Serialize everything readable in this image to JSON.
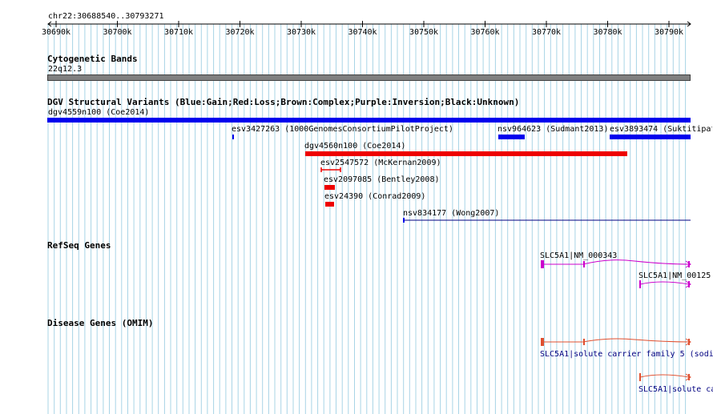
{
  "ruler": {
    "region": "chr22:30688540..30793271",
    "ticks": [
      "30690k",
      "30700k",
      "30710k",
      "30720k",
      "30730k",
      "30740k",
      "30750k",
      "30760k",
      "30770k",
      "30780k",
      "30790k"
    ]
  },
  "cytobands": {
    "title": "Cytogenetic Bands",
    "band": "22q12.3"
  },
  "dgv": {
    "title": "DGV Structural Variants (Blue:Gain;Red:Loss;Brown:Complex;Purple:Inversion;Black:Unknown)",
    "variants": [
      {
        "label": "dgv4559n100 (Coe2014)",
        "type": "gain"
      },
      {
        "label": "esv3427263 (1000GenomesConsortiumPilotProject)",
        "type": "gain"
      },
      {
        "label": "nsv964623 (Sudmant2013)",
        "type": "gain"
      },
      {
        "label": "esv3893474 (Suktitipat",
        "type": "gain"
      },
      {
        "label": "dgv4560n100 (Coe2014)",
        "type": "loss"
      },
      {
        "label": "esv2547572 (McKernan2009)",
        "type": "loss"
      },
      {
        "label": "esv2097085 (Bentley2008)",
        "type": "loss"
      },
      {
        "label": "esv24390 (Conrad2009)",
        "type": "loss"
      },
      {
        "label": "nsv834177 (Wong2007)",
        "type": "gain"
      }
    ]
  },
  "refseq": {
    "title": "RefSeq Genes",
    "genes": [
      {
        "label": "SLC5A1|NM_000343"
      },
      {
        "label": "SLC5A1|NM_00125"
      }
    ]
  },
  "omim": {
    "title": "Disease Genes (OMIM)",
    "genes": [
      {
        "label": "SLC5A1|solute carrier family 5 (sodi"
      },
      {
        "label": "SLC5A1|solute ca"
      }
    ]
  },
  "colors": {
    "gain": "#0000ee",
    "loss": "#ee0000",
    "refseq": "#cc00cc",
    "omim": "#e05030",
    "band": "#808080",
    "grid": "#a8d4e6"
  }
}
